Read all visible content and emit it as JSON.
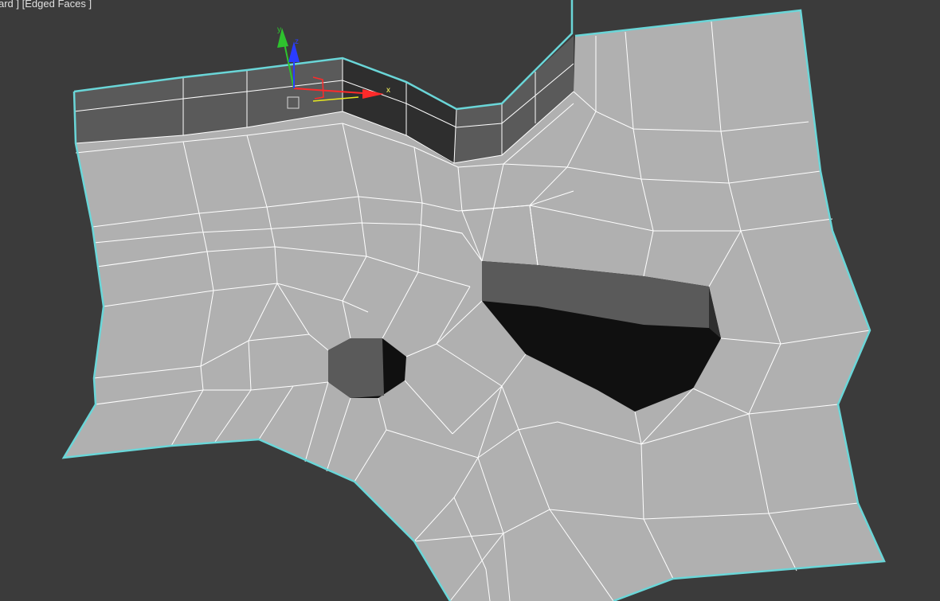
{
  "viewport": {
    "label": "ard ] [Edged Faces ]",
    "background": "#3b3b3b"
  },
  "mesh": {
    "face_color": "#b0b0b0",
    "wall_color": "#5a5a5a",
    "dark_wall_color": "#2e2e2e",
    "hole_color": "#101010",
    "edge_color": "#ffffff",
    "selection_border_color": "#6ad6d8"
  },
  "gizmo": {
    "x_label": "x",
    "y_label": "y",
    "z_label": "z",
    "x_color": "#ff2a2a",
    "y_color": "#2ec22e",
    "z_color": "#2a3cff"
  }
}
